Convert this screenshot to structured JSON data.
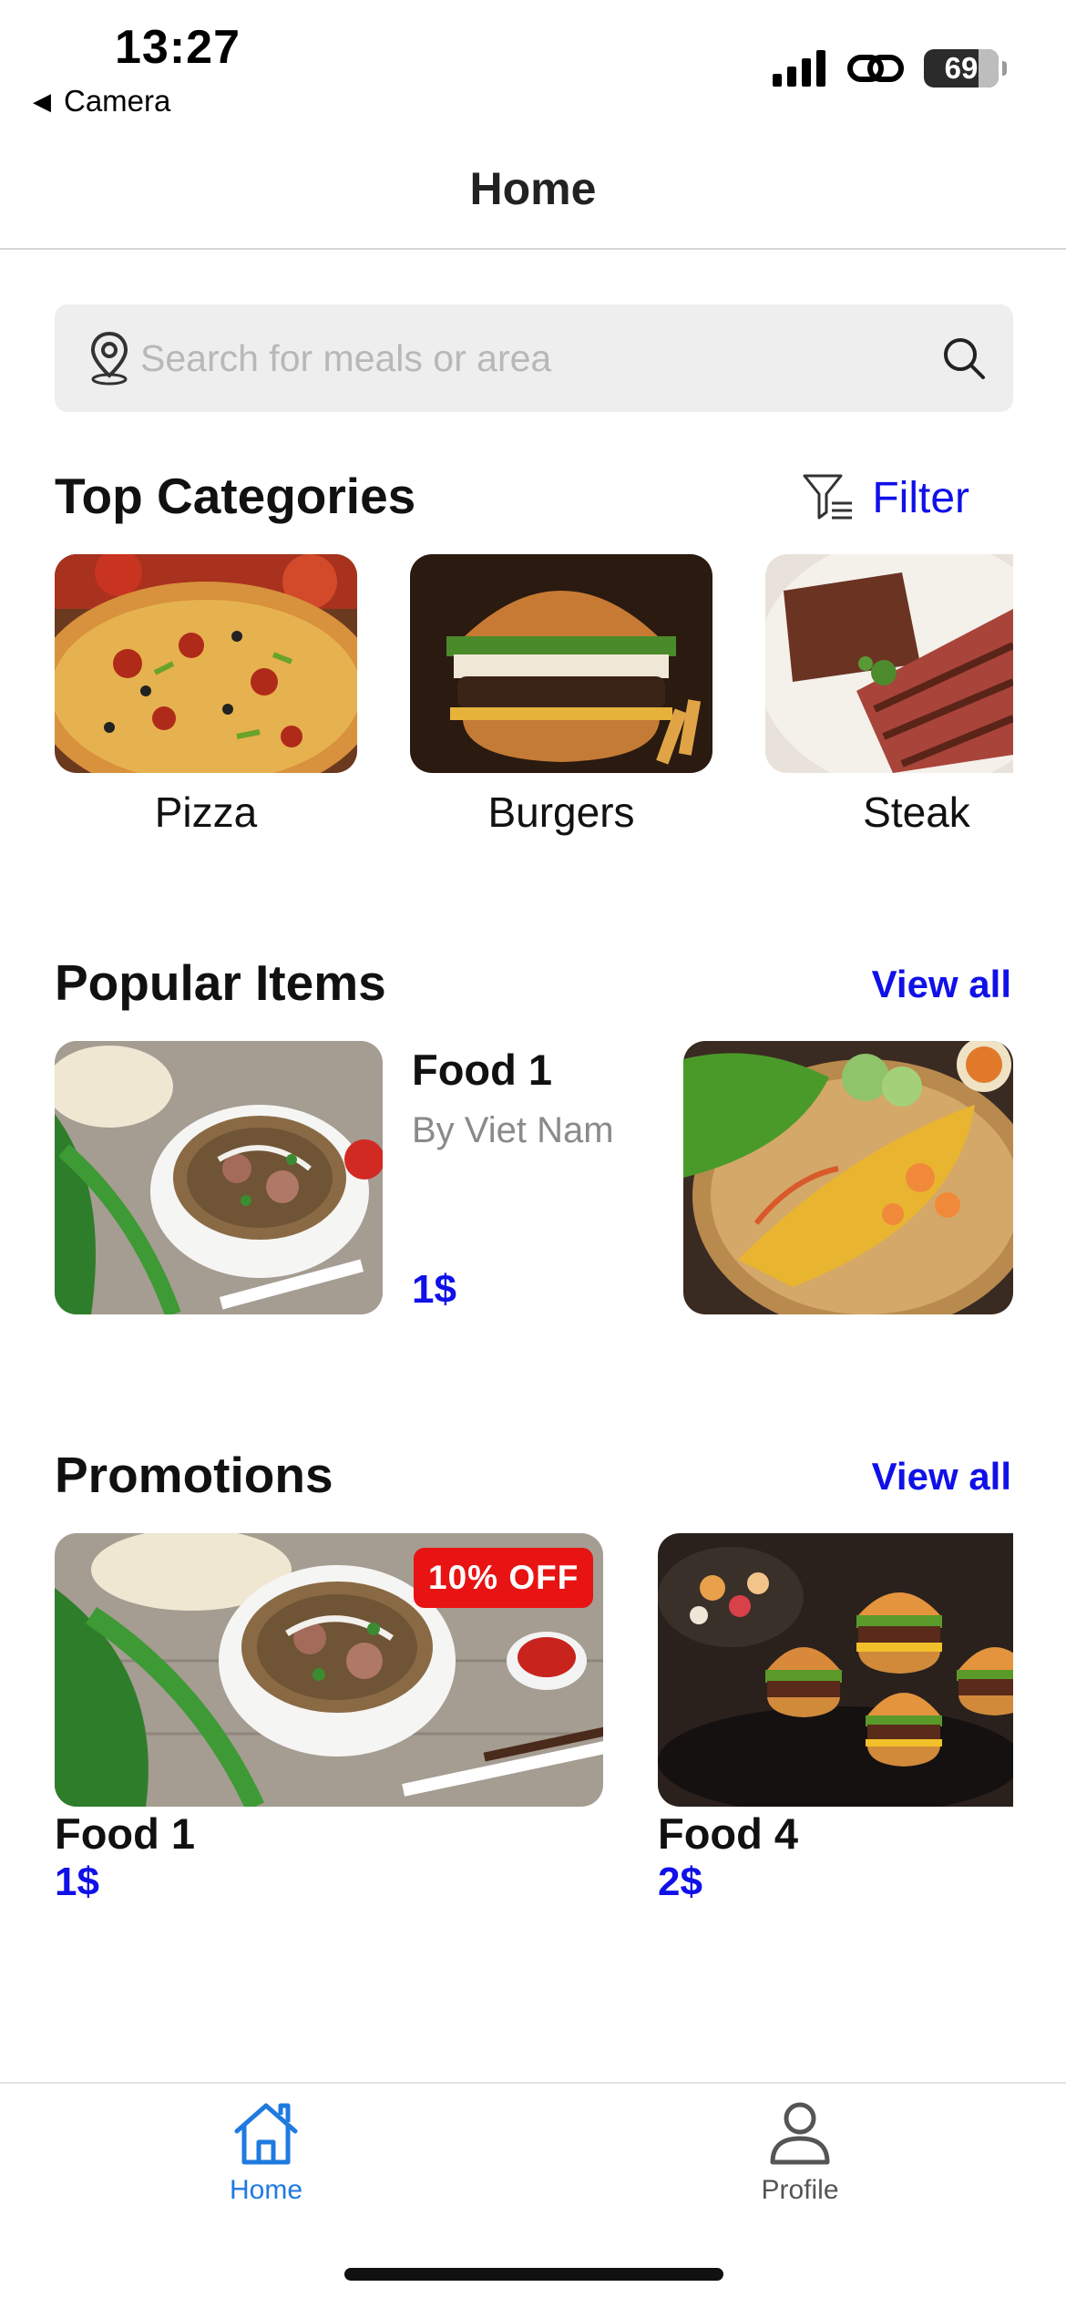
{
  "status_bar": {
    "time": "13:27",
    "back_app": "Camera",
    "battery": "69"
  },
  "header": {
    "title": "Home"
  },
  "search": {
    "placeholder": "Search for meals or area"
  },
  "categories": {
    "title": "Top Categories",
    "filter_label": "Filter",
    "items": [
      {
        "label": "Pizza"
      },
      {
        "label": "Burgers"
      },
      {
        "label": "Steak"
      }
    ]
  },
  "popular": {
    "title": "Popular Items",
    "view_all": "View all",
    "items": [
      {
        "name": "Food 1",
        "subtitle": "By Viet Nam",
        "price": "1$"
      }
    ]
  },
  "promotions": {
    "title": "Promotions",
    "view_all": "View all",
    "items": [
      {
        "name": "Food 1",
        "price": "1$",
        "badge": "10% OFF"
      },
      {
        "name": "Food 4",
        "price": "2$"
      }
    ]
  },
  "tabbar": {
    "items": [
      {
        "label": "Home",
        "active": true
      },
      {
        "label": "Profile",
        "active": false
      }
    ]
  },
  "colors": {
    "accent": "#1010e8",
    "tab_active": "#1f7ae0",
    "badge": "#e81313"
  }
}
